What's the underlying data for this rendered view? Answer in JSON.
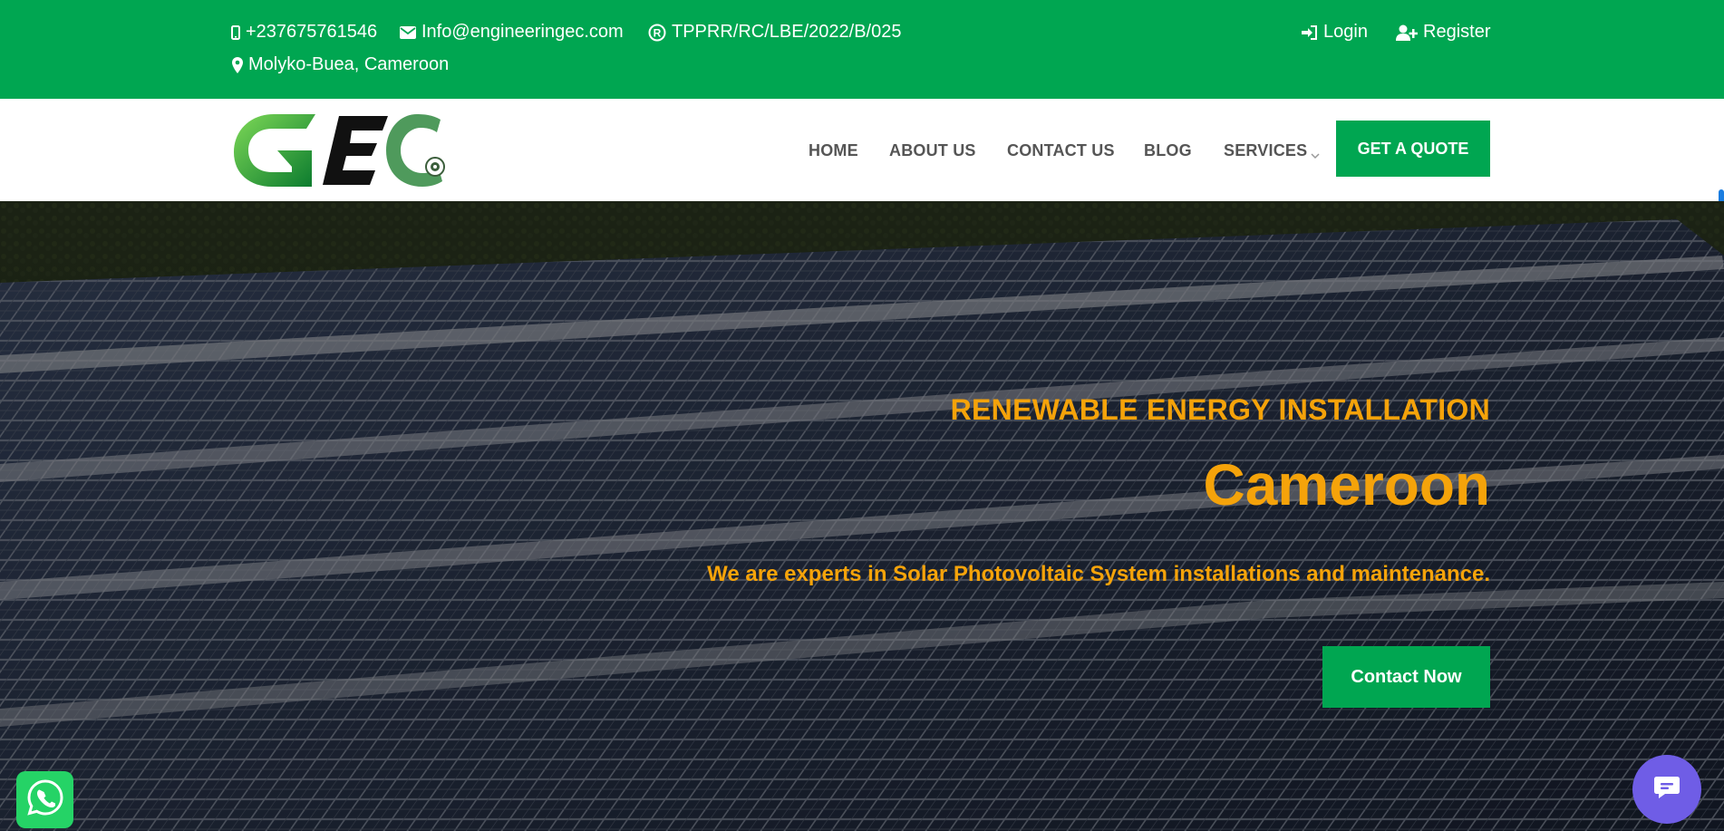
{
  "topbar": {
    "phone": "+237675761546",
    "email": "Info@engineeringec.com",
    "registration": "TPPRR/RC/LBE/2022/B/025",
    "location": "Molyko-Buea, Cameroon",
    "login_label": "Login",
    "register_label": "Register",
    "background_color": "#00a651"
  },
  "nav": {
    "items": [
      {
        "label": "HOME"
      },
      {
        "label": "ABOUT US"
      },
      {
        "label": "CONTACT US"
      },
      {
        "label": "BLOG"
      },
      {
        "label": "SERVICES"
      }
    ],
    "quote_button": "GET A QUOTE"
  },
  "hero": {
    "subtitle": "RENEWABLE ENERGY INSTALLATION",
    "title": "Cameroon",
    "description": "We are experts in Solar Photovoltaic System installations and maintenance.",
    "cta_label": "Contact Now",
    "accent_color": "#f5a30a"
  },
  "icons": {
    "phone": "mobile-phone-icon",
    "email": "envelope-icon",
    "registration": "registered-icon",
    "location": "map-marker-icon",
    "login": "sign-in-icon",
    "register": "user-plus-icon",
    "whatsapp": "whatsapp-icon",
    "chat": "chat-bubble-icon"
  }
}
